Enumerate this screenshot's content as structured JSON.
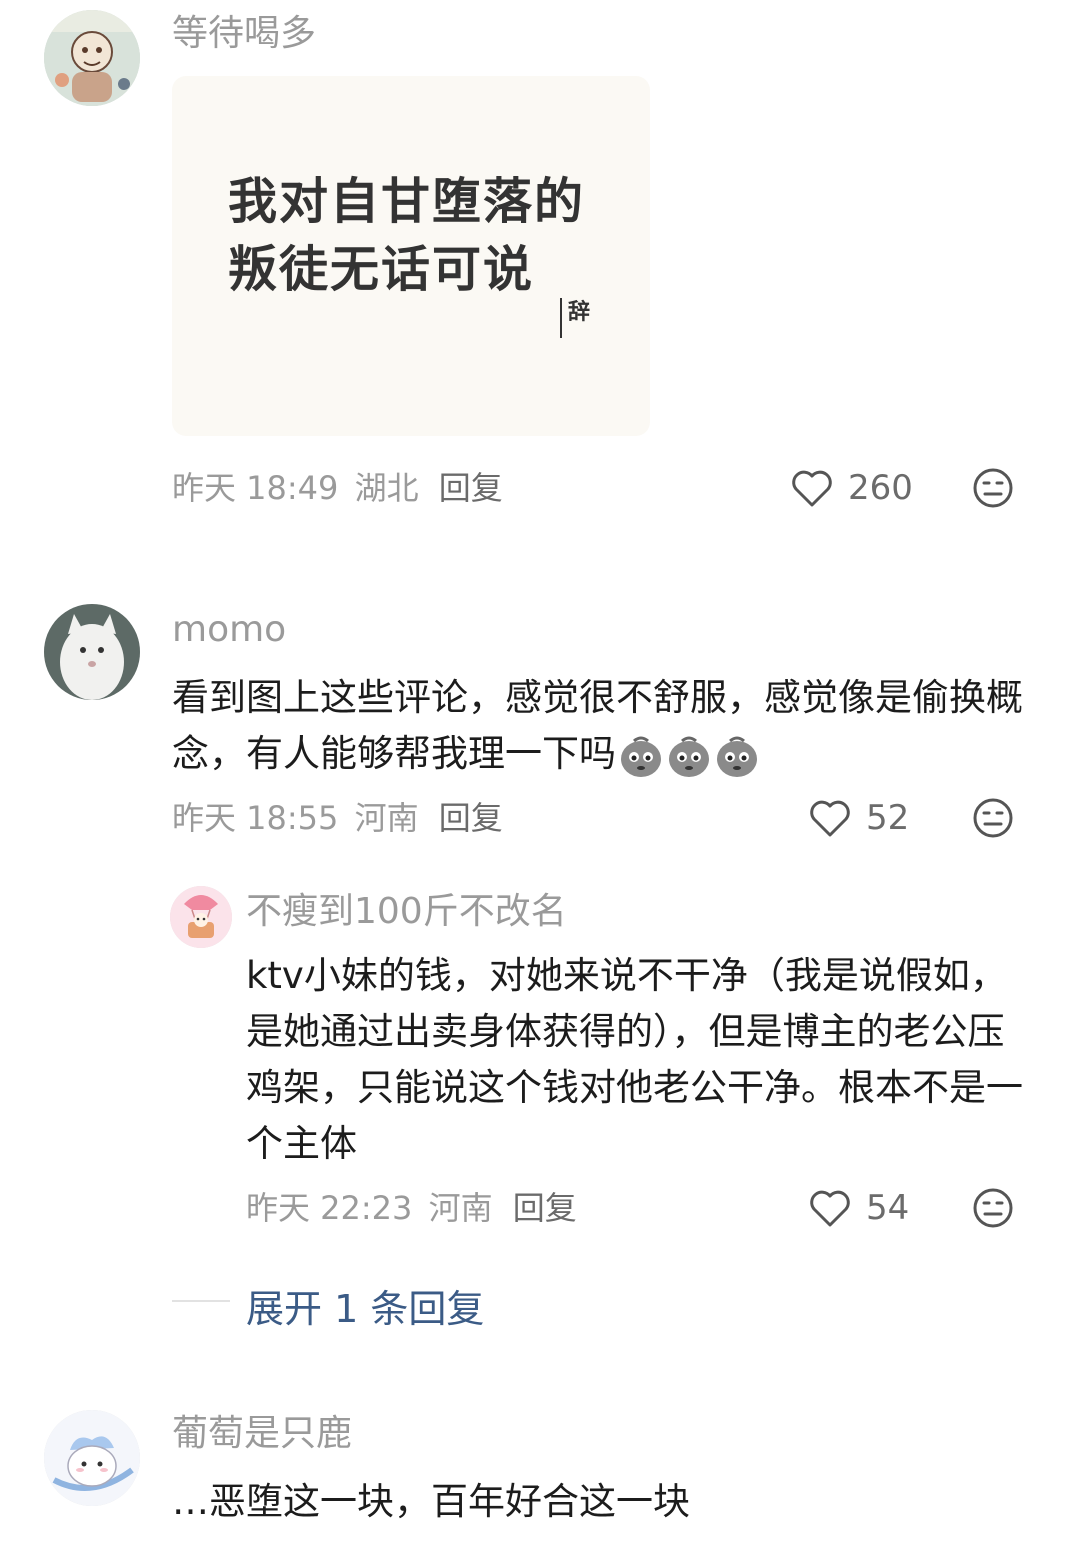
{
  "comments": [
    {
      "username": "等待喝多",
      "quote_image": {
        "line1": "我对自甘堕落的",
        "line2": "叛徒无话可说",
        "sign": "辞"
      },
      "time": "昨天 18:49",
      "location": "湖北",
      "reply_label": "回复",
      "likes": "260"
    },
    {
      "username": "momo",
      "text": "看到图上这些评论，感觉很不舒服，感觉像是偷换概念，有人能够帮我理一下吗",
      "time": "昨天 18:55",
      "location": "河南",
      "reply_label": "回复",
      "likes": "52",
      "replies": [
        {
          "username": "不瘦到100斤不改名",
          "text": "ktv小妹的钱，对她来说不干净（我是说假如，是她通过出卖身体获得的），但是博主的老公压鸡架，只能说这个钱对他老公干净。根本不是一个主体",
          "time": "昨天 22:23",
          "location": "河南",
          "reply_label": "回复",
          "likes": "54"
        }
      ],
      "expand_label": "展开 1 条回复"
    },
    {
      "username": "葡萄是只鹿",
      "text": "…恶堕这一块，百年好合这一块"
    }
  ],
  "colors": {
    "username": "#9a9a9a",
    "body": "#1c1c1c",
    "expand": "#3b5b86"
  }
}
